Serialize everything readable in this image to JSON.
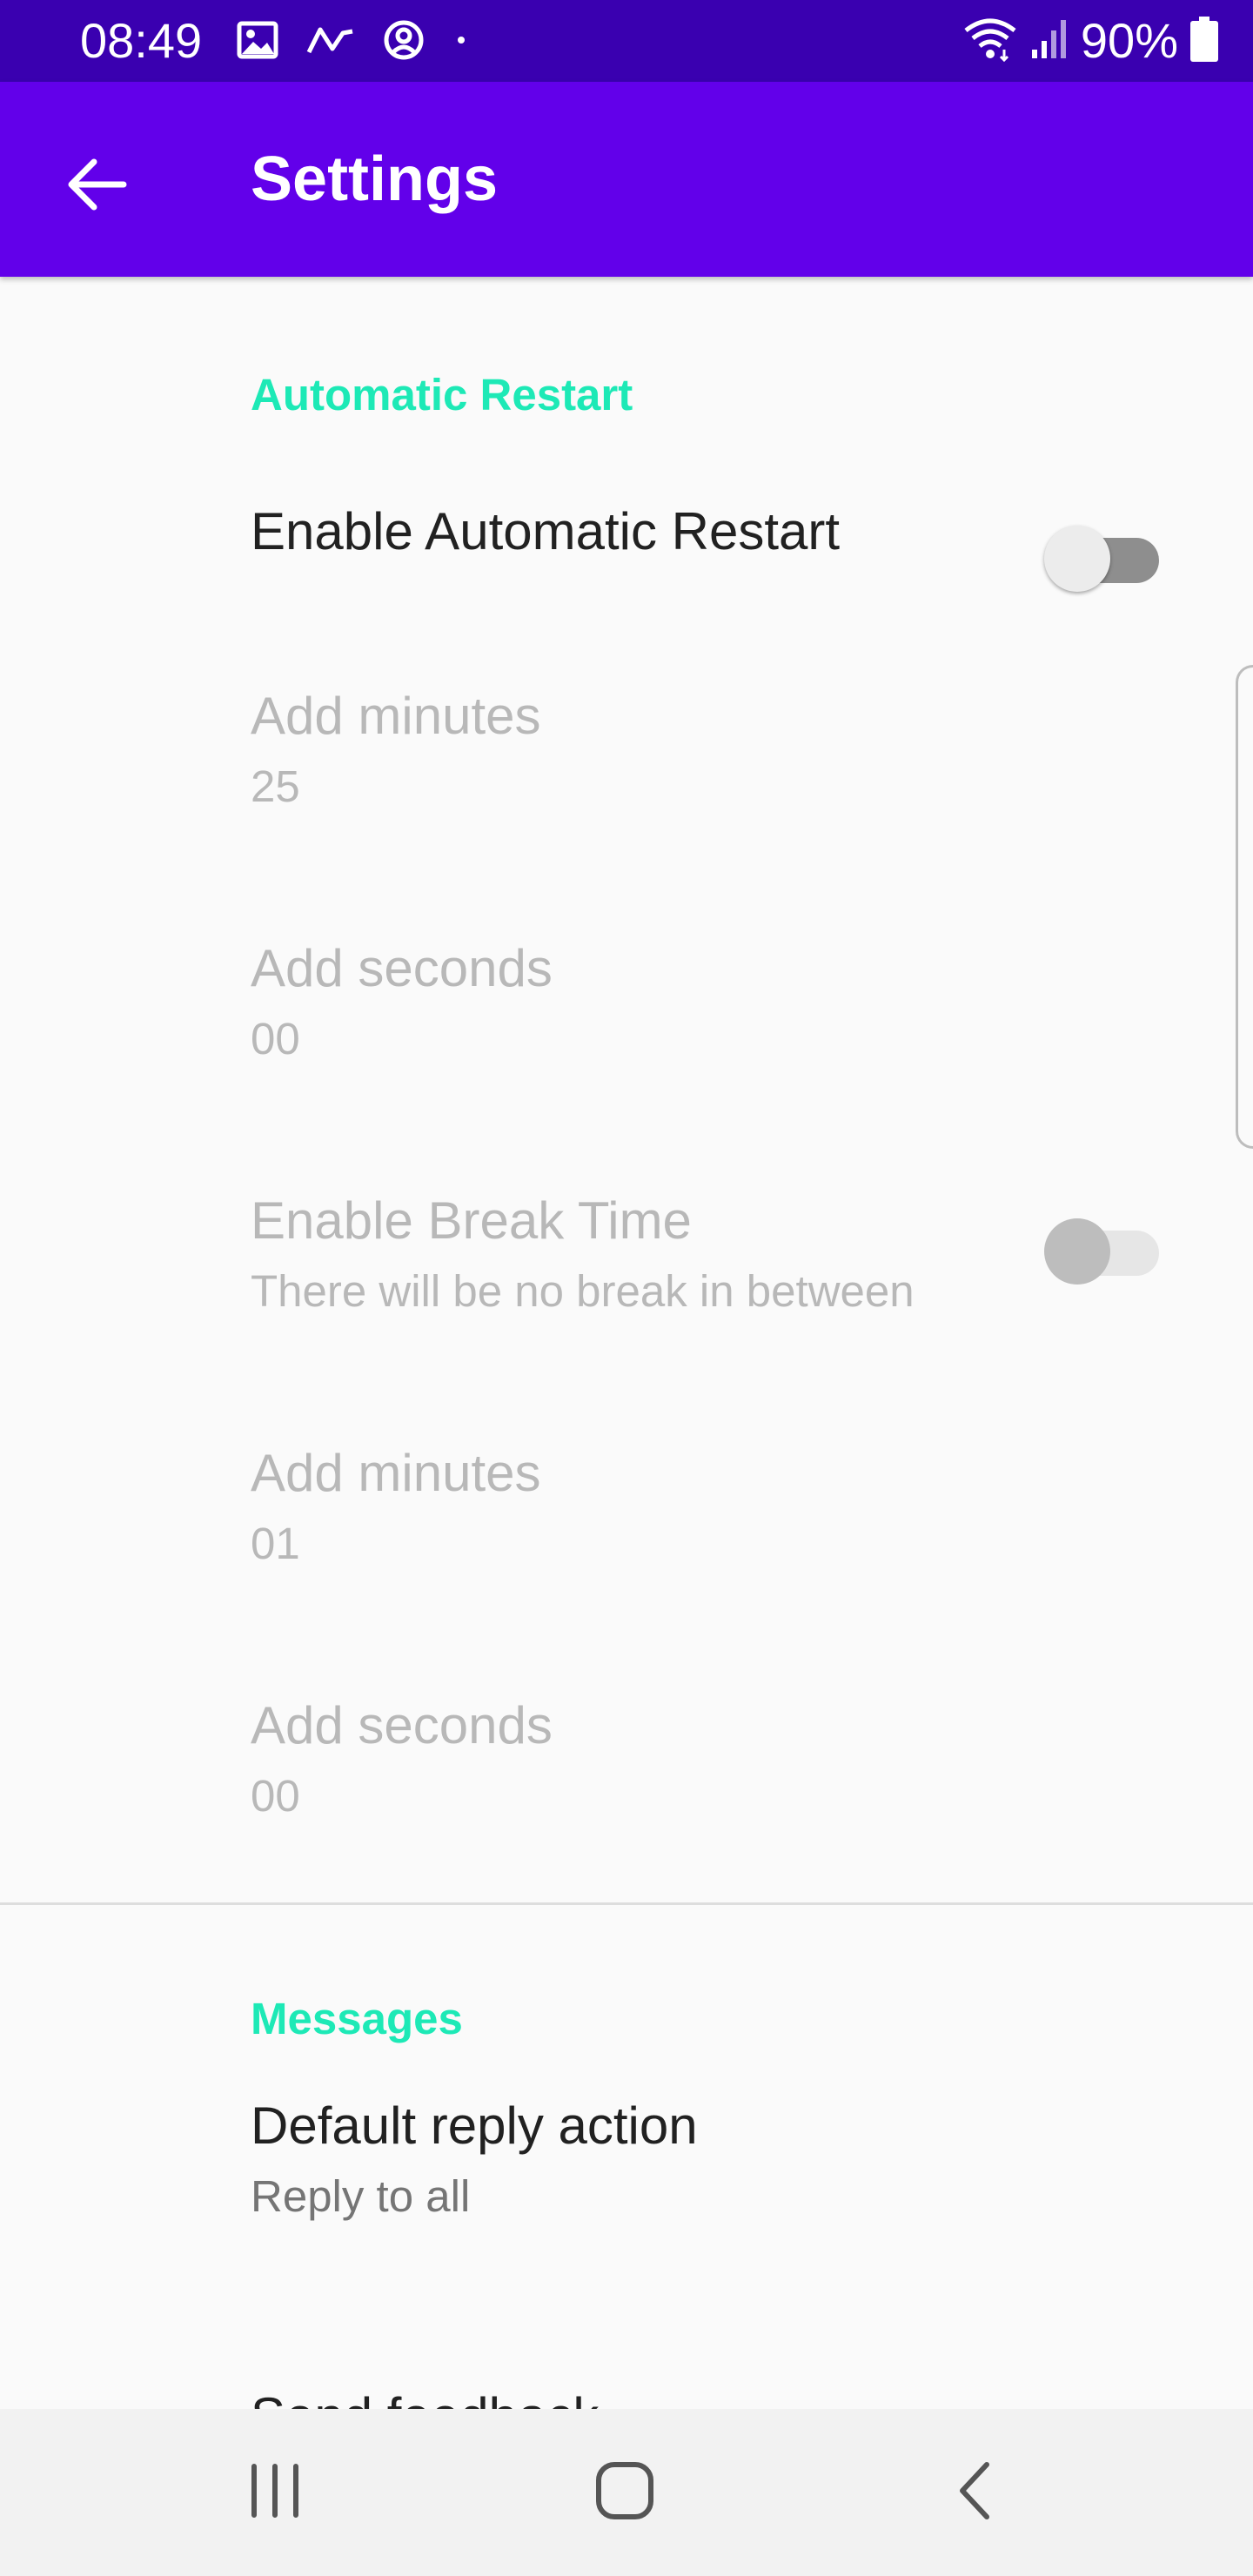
{
  "status_bar": {
    "time": "08:49",
    "battery_percent": "90%",
    "icons_left": [
      "image-icon",
      "trend-icon",
      "account-icon",
      "dot-icon"
    ],
    "icons_right": [
      "wifi-icon",
      "signal-icon",
      "battery-icon"
    ]
  },
  "app_bar": {
    "title": "Settings",
    "color": "#6200ea"
  },
  "sections": {
    "automatic_restart": {
      "title": "Automatic Restart",
      "enable": {
        "title": "Enable Automatic Restart",
        "checked": false
      },
      "add_minutes": {
        "title": "Add minutes",
        "value": "25"
      },
      "add_seconds": {
        "title": "Add seconds",
        "value": "00"
      },
      "break_time": {
        "title": "Enable Break Time",
        "summary": "There will be no break in between",
        "checked": false
      },
      "break_minutes": {
        "title": "Add minutes",
        "value": "01"
      },
      "break_seconds": {
        "title": "Add seconds",
        "value": "00"
      }
    },
    "messages": {
      "title": "Messages",
      "default_reply": {
        "title": "Default reply action",
        "summary": "Reply to all"
      },
      "partial_item": {
        "title": "Send feedback"
      }
    }
  },
  "nav_bar": {
    "icons": [
      "recents-icon",
      "home-icon",
      "back-icon"
    ]
  },
  "colors": {
    "accent": "#1de9b6",
    "status_bar": "#3a00b0",
    "primary": "#6200ea"
  }
}
